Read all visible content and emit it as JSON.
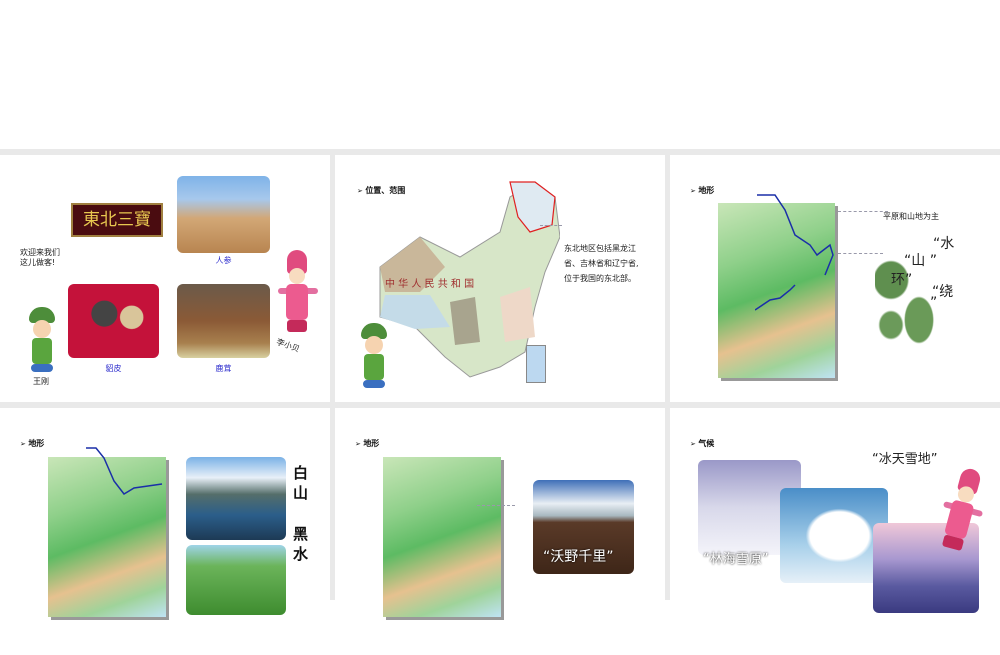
{
  "slides": [
    {
      "plaque": "東北三寶",
      "welcome_line1": "欢迎来我们",
      "welcome_line2": "这儿做客!",
      "ginseng": "人参",
      "mink": "貂皮",
      "antler": "鹿茸",
      "boy": "王刚",
      "girl": "李小贝"
    },
    {
      "heading": "位置、范围",
      "text_line1": "东北地区包括黑龙江",
      "text_line2": "省、吉林省和辽宁省,",
      "text_line3": "位于我国的东北部。",
      "map_label": "中 华 人 民 共 和 国"
    },
    {
      "heading": "地形",
      "caption": "平原和山地为主",
      "q1": "“水",
      "q2": "“山 ”",
      "q3": "环”",
      "q4": "“绕",
      "q5": "”"
    },
    {
      "heading": "地形",
      "white": "白山",
      "black": "黑水"
    },
    {
      "heading": "地形",
      "caption": "“沃野千里”"
    },
    {
      "heading": "气候",
      "caption1": "“冰天雪地”",
      "caption2": "“林海雪原”"
    }
  ],
  "colors": {
    "background": "#e9e9e9",
    "slide": "#ffffff",
    "label": "#2a2acc"
  }
}
